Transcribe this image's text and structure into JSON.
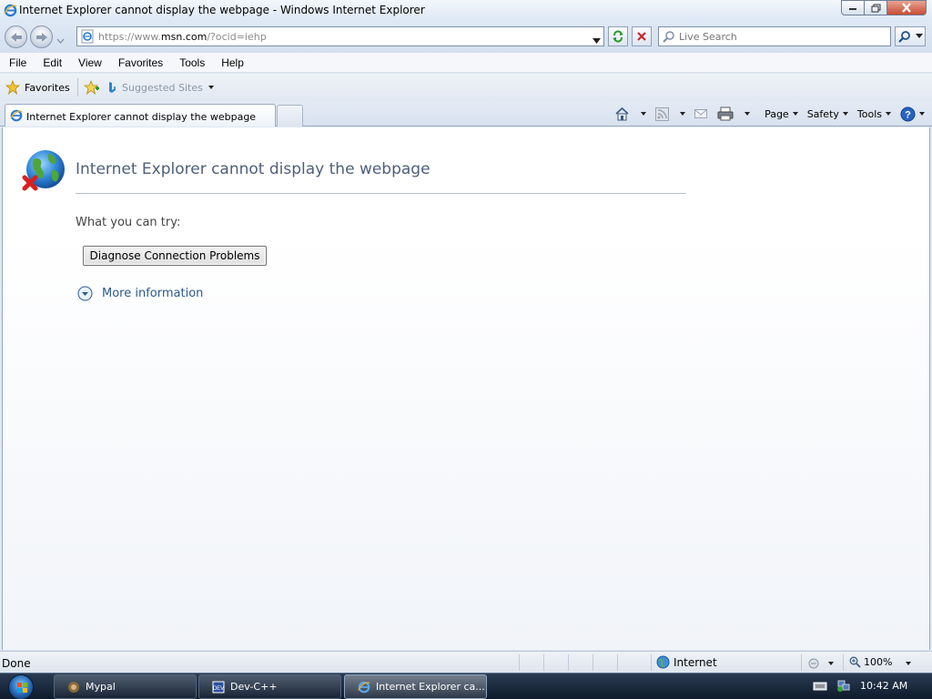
{
  "window": {
    "title": "Internet Explorer cannot display the webpage - Windows Internet Explorer"
  },
  "address": {
    "url_prefix": "https://www.",
    "url_host": "msn.com",
    "url_rest": "/?ocid=iehp"
  },
  "search": {
    "placeholder": "Live Search"
  },
  "menu": {
    "items": [
      "File",
      "Edit",
      "View",
      "Favorites",
      "Tools",
      "Help"
    ]
  },
  "favorites_bar": {
    "favorites_label": "Favorites",
    "suggested_label": "Suggested Sites"
  },
  "tab": {
    "label": "Internet Explorer cannot display the webpage"
  },
  "command_bar": {
    "page_label": "Page",
    "safety_label": "Safety",
    "tools_label": "Tools"
  },
  "content": {
    "heading": "Internet Explorer cannot display the webpage",
    "try_text": "What you can try:",
    "diagnose_button": "Diagnose Connection Problems",
    "more_info": "More information"
  },
  "status_bar": {
    "status_text": "Done",
    "zone": "Internet",
    "zoom": "100%"
  },
  "taskbar": {
    "buttons": [
      "Mypal",
      "Dev-C++",
      "Internet Explorer ca..."
    ],
    "clock": "10:42 AM"
  },
  "colors": {
    "heading_color": "#4e5f7a",
    "link_color": "#2b5a8c",
    "taskbar_color": "#1b2a3f"
  }
}
